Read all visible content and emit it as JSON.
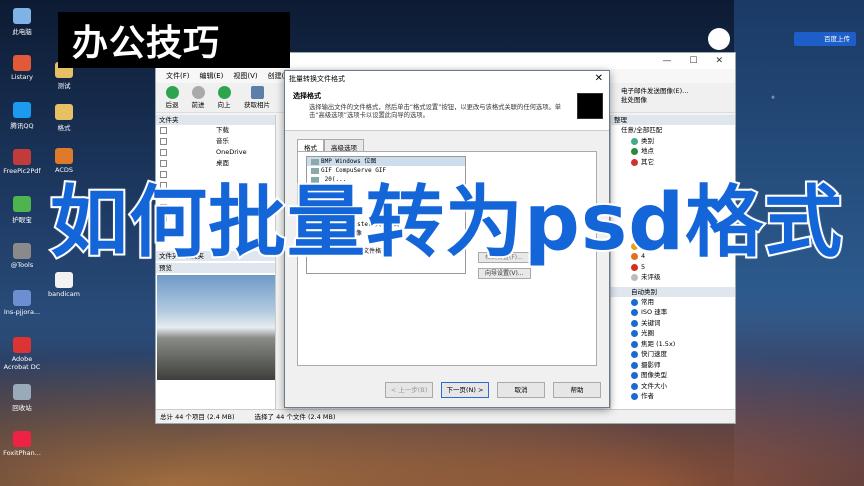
{
  "banner": {
    "text": "办公技巧"
  },
  "overlay_title": "如何批量转为psd格式",
  "upload_button": "百度上传",
  "desktop_icons": [
    {
      "label": "此电脑",
      "color": "#7fb3e6"
    },
    {
      "label": "Listary",
      "color": "#e05a3a"
    },
    {
      "label": "腾讯QQ",
      "color": "#1a9bef"
    },
    {
      "label": "FreePic2Pdf",
      "color": "#c23b3b"
    },
    {
      "label": "护眼宝",
      "color": "#4fb34f"
    },
    {
      "label": "@Tools",
      "color": "#8a8a8a"
    },
    {
      "label": "Ins-pjjora...",
      "color": "#6b8fd0"
    },
    {
      "label": "Adobe Acrobat DC",
      "color": "#d33"
    },
    {
      "label": "回收站",
      "color": "#9ab"
    },
    {
      "label": "FoxitPhan...",
      "color": "#e24"
    }
  ],
  "desktop_icons_col2": [
    {
      "label": "测试",
      "color": "#e8c064"
    },
    {
      "label": "格式",
      "color": "#e8c064"
    },
    {
      "label": "ACDS",
      "color": "#e07a2a"
    },
    {
      "label": "bandicam",
      "color": "#f2f2f2"
    }
  ],
  "explorer": {
    "menu": [
      "文件(F)",
      "编辑(E)",
      "视图(V)",
      "创建(C)"
    ],
    "toolbar": [
      "后退",
      "前进",
      "向上",
      "获取相片"
    ],
    "folder_panel_title": "文件夹",
    "tree": [
      "下载",
      "音乐",
      "OneDrive",
      "桌面"
    ],
    "tabs": [
      "文件夹",
      "收藏夹"
    ],
    "preview_title": "预览",
    "right_header": "整理",
    "right_filter": "任意/全部匹配",
    "right_items": [
      "类别",
      "地点",
      "其它",
      "3",
      "4",
      "5",
      "未评级"
    ],
    "auto_category": "自动类别",
    "auto_items": [
      "常用",
      "ISO 速率",
      "关键词",
      "光圈",
      "焦距 (1.5x)",
      "快门速度",
      "摄影师",
      "图像类型",
      "文件大小",
      "作者"
    ],
    "right_top_text": "电子邮件发送图像(E)...",
    "right_top_text2": "批处图像",
    "status_total": "总计 44 个项目 (2.4 MB)",
    "status_selected": "选择了 44 个文件 (2.4 MB)"
  },
  "dialog": {
    "title": "批量转换文件格式",
    "heading": "选择格式",
    "description": "选择输出文件的文件格式，然后单击“格式设置”按钮，以更改与该格式关联的任何选项。单击“高级选项”选项卡以设置此向导的选项。",
    "tabs": [
      "格式",
      "高级选项"
    ],
    "formats": [
      {
        "code": "BMP",
        "name": "Windows 位图"
      },
      {
        "code": "GIF",
        "name": "CompuServe GIF"
      },
      {
        "code": "",
        "name": "20(..."
      },
      {
        "code": "",
        "name": "..."
      },
      {
        "code": "",
        "name": "编码"
      },
      {
        "code": "",
        "name": "..."
      },
      {
        "code": "",
        "name": "...(X)"
      },
      {
        "code": "RAS",
        "name": "Sun Raster 文件格式"
      },
      {
        "code": "SGI",
        "name": "SGI 图像"
      },
      {
        "code": "TGA",
        "name": "Targa"
      },
      {
        "code": "TIFF",
        "name": "标记图像文件格式"
      }
    ],
    "format_settings_button": "格式设置(F)...",
    "wizard_settings_button": "向导设置(V)...",
    "back_button": "< 上一步(B)",
    "next_button": "下一页(N) >",
    "cancel_button": "取消",
    "help_button": "帮助"
  }
}
